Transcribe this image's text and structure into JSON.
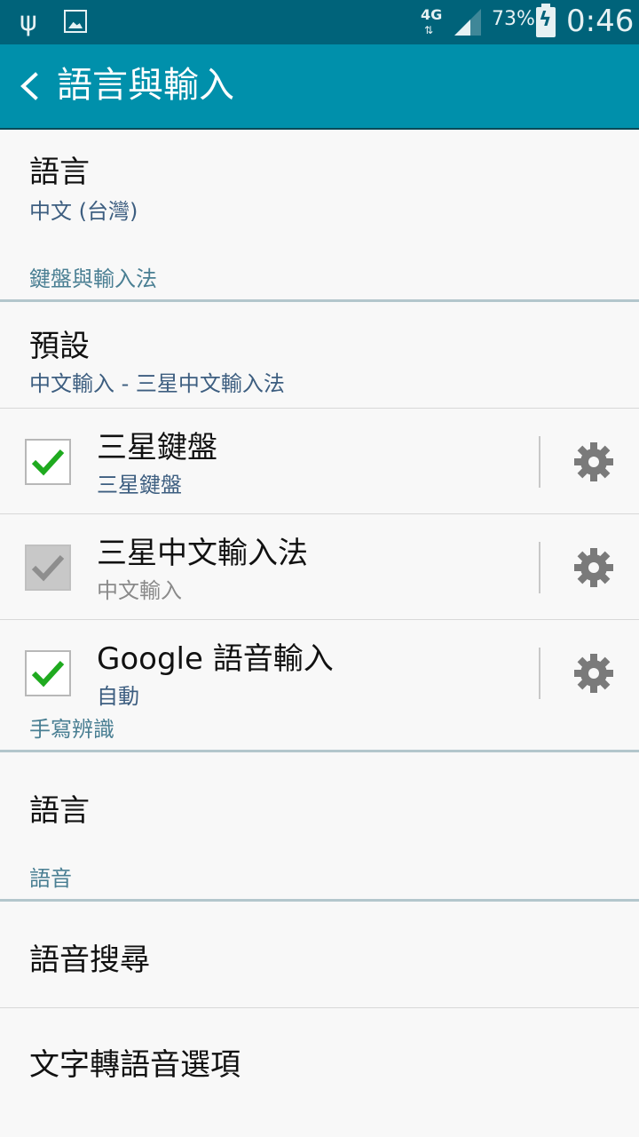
{
  "status_bar": {
    "network": "4G",
    "network_arrows": "⇅",
    "battery_percent": "73%",
    "time": "0:46"
  },
  "app_bar": {
    "title": "語言與輸入"
  },
  "language": {
    "title": "語言",
    "value": "中文 (台灣)"
  },
  "keyboard_section": {
    "header": "鍵盤與輸入法",
    "default": {
      "title": "預設",
      "value": "中文輸入 - 三星中文輸入法"
    },
    "input_methods": [
      {
        "title": "三星鍵盤",
        "subtitle": "三星鍵盤",
        "checked": true,
        "enabled": true
      },
      {
        "title": "三星中文輸入法",
        "subtitle": "中文輸入",
        "checked": true,
        "enabled": false
      },
      {
        "title": "Google 語音輸入",
        "subtitle": "自動",
        "checked": true,
        "enabled": true
      }
    ]
  },
  "handwriting_section": {
    "header": "手寫辨識",
    "language": "語言"
  },
  "voice_section": {
    "header": "語音",
    "voice_search": "語音搜尋",
    "tts_options": "文字轉語音選項"
  },
  "colors": {
    "status_bar": "#00637a",
    "app_bar": "#0090ab",
    "check_green": "#1faa1f",
    "section_header": "#4a7f93"
  },
  "icons": {
    "back": "chevron-left-icon",
    "settings": "gear-icon",
    "usb": "usb-icon",
    "gallery": "image-icon",
    "signal": "signal-icon",
    "battery": "battery-charging-icon"
  }
}
